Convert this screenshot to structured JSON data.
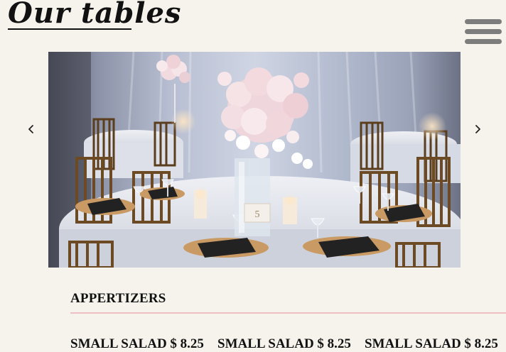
{
  "header": {
    "title": "Our tables",
    "menu_icon": "hamburger-menu-icon"
  },
  "carousel": {
    "prev_icon": "chevron-left-icon",
    "next_icon": "chevron-right-icon",
    "image_subject": "banquet-table-with-floral-centerpiece",
    "table_number": "5"
  },
  "menu": {
    "section_heading": "APPERTIZERS",
    "items": [
      {
        "label": "SMALL SALAD $ 8.25"
      },
      {
        "label": "SMALL SALAD $ 8.25"
      },
      {
        "label": "SMALL SALAD $ 8.25"
      }
    ]
  },
  "colors": {
    "background": "#f6f3ec",
    "divider": "#efbdc4",
    "hamburger": "#7d7d7d",
    "text": "#111111"
  }
}
